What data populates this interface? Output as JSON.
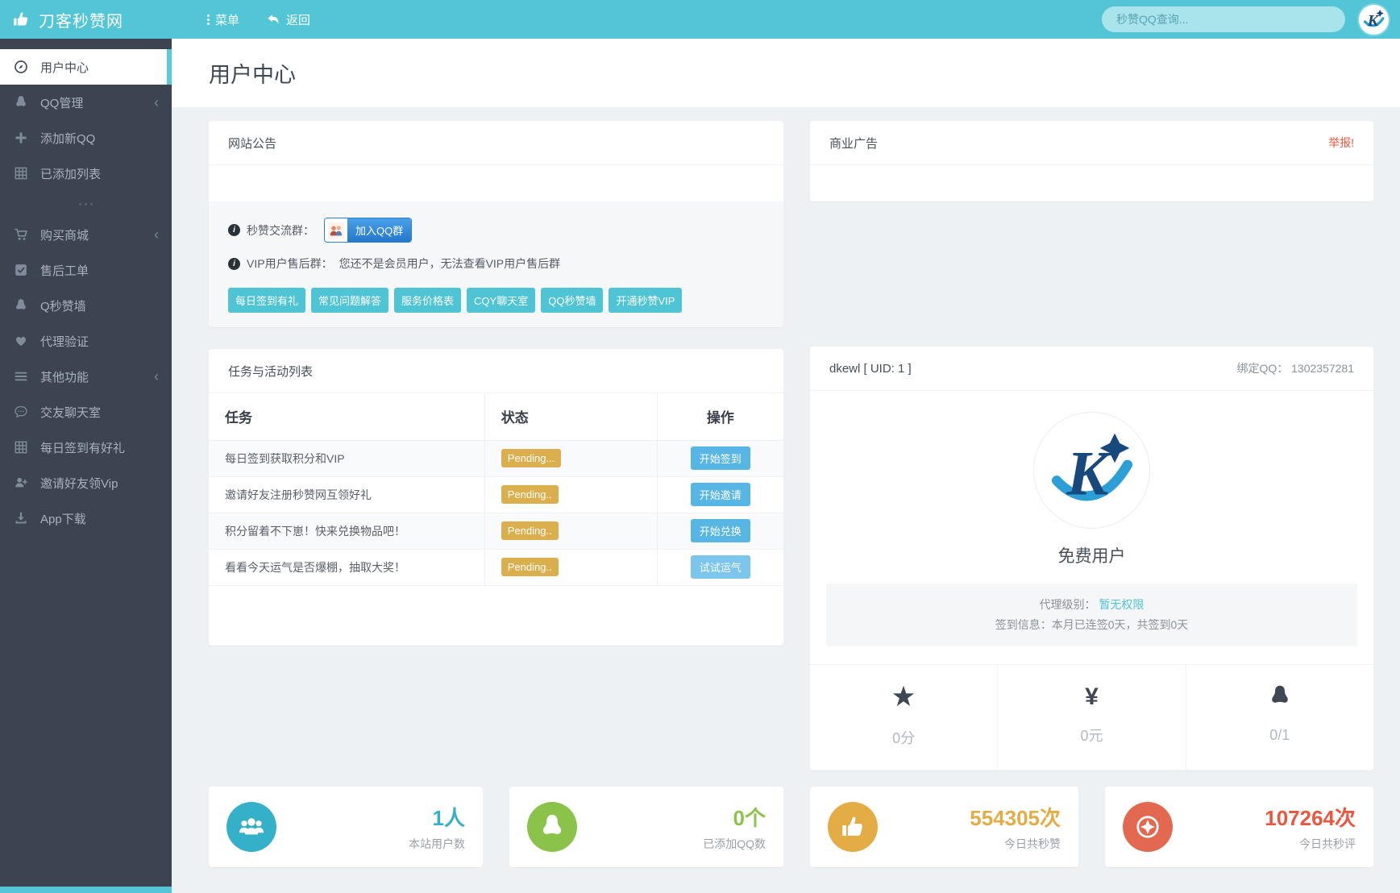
{
  "topbar": {
    "brand": "刀客秒赞网",
    "menu_label": "菜单",
    "back_label": "返回",
    "search_placeholder": "秒赞QQ查询..."
  },
  "page": {
    "title": "用户中心"
  },
  "sidebar": {
    "items": [
      {
        "label": "用户中心"
      },
      {
        "label": "QQ管理"
      },
      {
        "label": "添加新QQ"
      },
      {
        "label": "已添加列表"
      },
      {
        "label": "购买商城"
      },
      {
        "label": "售后工单"
      },
      {
        "label": "Q秒赞墙"
      },
      {
        "label": "代理验证"
      },
      {
        "label": "其他功能"
      },
      {
        "label": "交友聊天室"
      },
      {
        "label": "每日签到有好礼"
      },
      {
        "label": "邀请好友领Vip"
      },
      {
        "label": "App下载"
      }
    ]
  },
  "announcement": {
    "title": "网站公告",
    "group_label": "秒赞交流群：",
    "join_group_button": "加入QQ群",
    "vip_label": "VIP用户售后群：",
    "vip_text": "您还不是会员用户，无法查看VIP用户售后群",
    "quick_links": [
      "每日签到有礼",
      "常见问题解答",
      "服务价格表",
      "CQY聊天室",
      "QQ秒赞墙",
      "开通秒赞VIP"
    ]
  },
  "ad": {
    "title": "商业广告",
    "report_link": "举报!"
  },
  "tasks": {
    "title": "任务与活动列表",
    "columns": [
      "任务",
      "状态",
      "操作"
    ],
    "rows": [
      {
        "task": "每日签到获取积分和VIP",
        "status": "Pending...",
        "action": "开始签到"
      },
      {
        "task": "邀请好友注册秒赞网互领好礼",
        "status": "Pending..",
        "action": "开始邀请"
      },
      {
        "task": "积分留着不下崽！快来兑换物品吧！",
        "status": "Pending..",
        "action": "开始兑换"
      },
      {
        "task": "看看今天运气是否爆棚，抽取大奖！",
        "status": "Pending..",
        "action": "试试运气"
      }
    ]
  },
  "profile": {
    "username": "dkewl [ UID:  1 ]",
    "bound_qq": "绑定QQ：  1302357281",
    "level_name": "免费用户",
    "agent_label": "代理级别：",
    "agent_value": "暂无权限",
    "signin_text": "签到信息：本月已连签0天，共签到0天",
    "stats": [
      {
        "icon": "star-icon",
        "value": "0分"
      },
      {
        "icon": "yen-icon",
        "glyph": "¥",
        "value": "0元"
      },
      {
        "icon": "qq-icon",
        "value": "0/1"
      }
    ]
  },
  "summary_cards": [
    {
      "icon": "users-icon",
      "value": "1人",
      "label": "本站用户数",
      "color": "#34b0c9"
    },
    {
      "icon": "qq-icon",
      "value": "0个",
      "label": "已添加QQ数",
      "color": "#8bc34a"
    },
    {
      "icon": "thumb-icon",
      "value": "554305次",
      "label": "今日共秒赞",
      "color": "#e3ac44"
    },
    {
      "icon": "starburst-icon",
      "value": "107264次",
      "label": "今日共秒评",
      "color": "#e9573f"
    }
  ],
  "colors": {
    "topbar_teal": "#52c6d6",
    "sidebar_dark": "#3b4450",
    "accent_teal": "#4fc4d4",
    "pending_badge": "#dcaf4e",
    "action_blue": "#58b6e4",
    "report_orange": "#f0543c"
  }
}
